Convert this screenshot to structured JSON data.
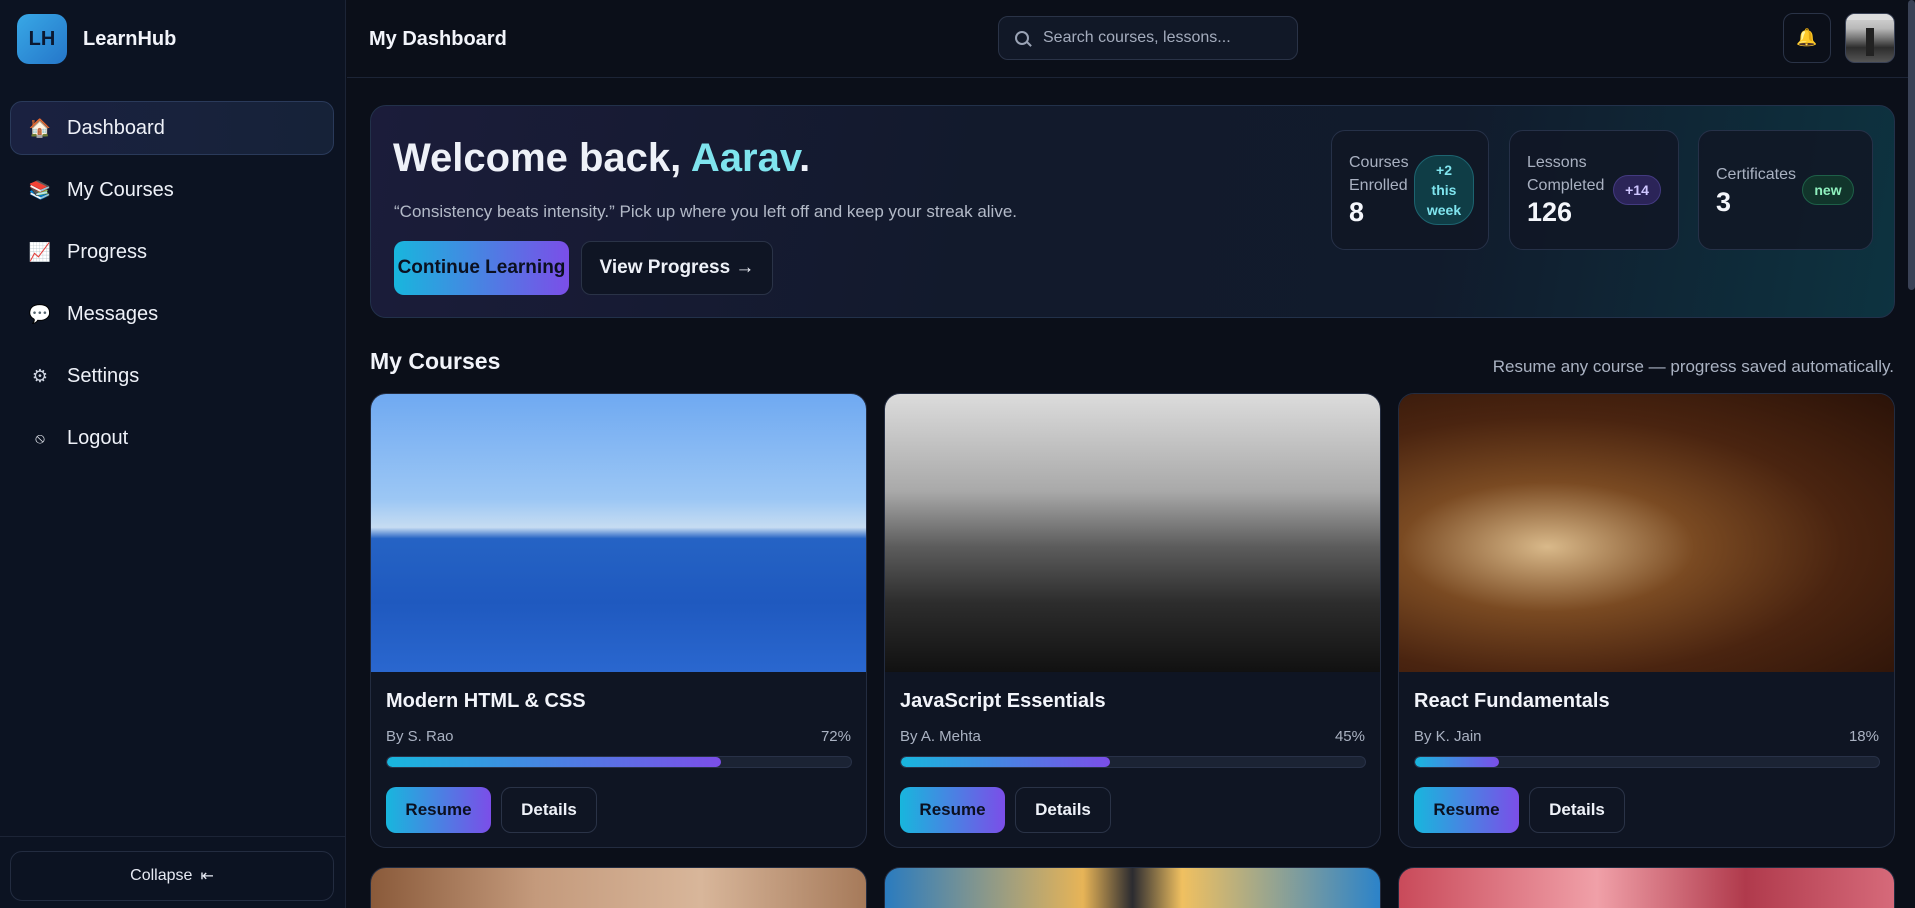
{
  "brand": {
    "logo": "LH",
    "name": "LearnHub"
  },
  "sidebar": {
    "items": [
      {
        "label": "Dashboard",
        "icon": "home-icon",
        "glyph": "🏠",
        "active": true
      },
      {
        "label": "My Courses",
        "icon": "books-icon",
        "glyph": "📚",
        "active": false
      },
      {
        "label": "Progress",
        "icon": "chart-icon",
        "glyph": "📈",
        "active": false
      },
      {
        "label": "Messages",
        "icon": "speech-bubble-icon",
        "glyph": "💬",
        "active": false
      },
      {
        "label": "Settings",
        "icon": "gear-icon",
        "glyph": "⚙",
        "active": false
      },
      {
        "label": "Logout",
        "icon": "logout-icon",
        "glyph": "⦸",
        "active": false
      }
    ],
    "collapse_label": "Collapse",
    "collapse_arrow": "⇤"
  },
  "header": {
    "title": "My Dashboard",
    "search_placeholder": "Search courses, lessons...",
    "bell_glyph": "🔔"
  },
  "hero": {
    "greeting": "Welcome back, ",
    "name": "Aarav",
    "punct": ".",
    "subtitle": "“Consistency beats intensity.” Pick up where you left off and keep your streak alive.",
    "primary_button": "Continue Learning",
    "secondary_button": "View Progress →"
  },
  "stats": [
    {
      "label_line1": "Courses",
      "label_line2": "Enrolled",
      "value": "8",
      "badge_line1": "+2",
      "badge_line2": "this",
      "badge_line3": "week"
    },
    {
      "label_line1": "Lessons",
      "label_line2": "Completed",
      "value": "126",
      "badge": "+14"
    },
    {
      "label": "Certificates",
      "value": "3",
      "badge": "new"
    }
  ],
  "courses_section": {
    "title": "My Courses",
    "note": "Resume any course — progress saved automatically."
  },
  "courses": [
    {
      "title": "Modern HTML & CSS",
      "author": "By S. Rao",
      "progress": 72,
      "progress_label": "72%",
      "resume": "Resume",
      "details": "Details"
    },
    {
      "title": "JavaScript Essentials",
      "author": "By A. Mehta",
      "progress": 45,
      "progress_label": "45%",
      "resume": "Resume",
      "details": "Details"
    },
    {
      "title": "React Fundamentals",
      "author": "By K. Jain",
      "progress": 18,
      "progress_label": "18%",
      "resume": "Resume",
      "details": "Details"
    }
  ]
}
